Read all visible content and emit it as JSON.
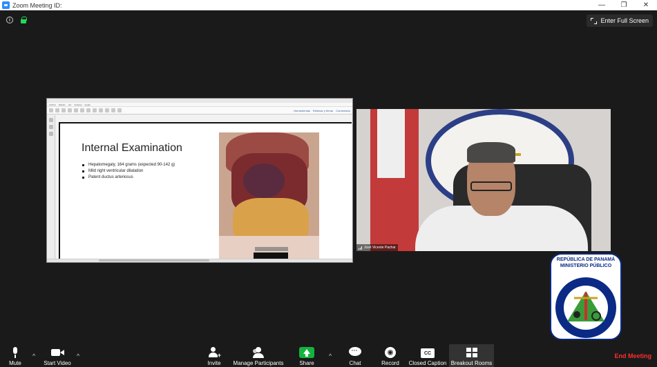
{
  "window": {
    "title": "Zoom Meeting ID:",
    "minimize_glyph": "—",
    "restore_glyph": "❐",
    "close_glyph": "✕"
  },
  "header": {
    "info_glyph": "i",
    "fullscreen_label": "Enter Full Screen"
  },
  "shared_screen": {
    "menu_items": [
      "Archivo",
      "Edición",
      "Ver",
      "Ventana",
      "Ayuda"
    ],
    "toolbar_right": [
      "Herramientas",
      "Rellenar y firmar",
      "Comentario"
    ],
    "slide": {
      "title": "Internal Examination",
      "bullets": [
        "Hepatomegaly, 164 grams (expected 90-142 g)",
        "Mild right ventricular dilatation",
        "Patent ductus arteriosus"
      ]
    }
  },
  "video_tile": {
    "participant_name": "José Vicente Pachar"
  },
  "logo": {
    "line1": "REPÚBLICA DE PANAMÁ",
    "line2": "MINISTERIO PÚBLICO",
    "ring_text": "INSTITUTO DE MEDICINA LEGAL Y CIENCIAS FORENSES"
  },
  "toolbar": {
    "mute": "Mute",
    "start_video": "Start Video",
    "invite": "Invite",
    "manage_participants": "Manage Participants",
    "share": "Share",
    "chat": "Chat",
    "record": "Record",
    "closed_caption": "Closed Caption",
    "cc_glyph": "CC",
    "breakout_rooms": "Breakout Rooms",
    "end_meeting": "End Meeting",
    "caret_glyph": "^"
  },
  "colors": {
    "background": "#1a1a1a",
    "share_green": "#12b33e",
    "end_red": "#ff2d2d",
    "zoom_blue": "#2d8cff",
    "lock_green": "#23d959"
  }
}
